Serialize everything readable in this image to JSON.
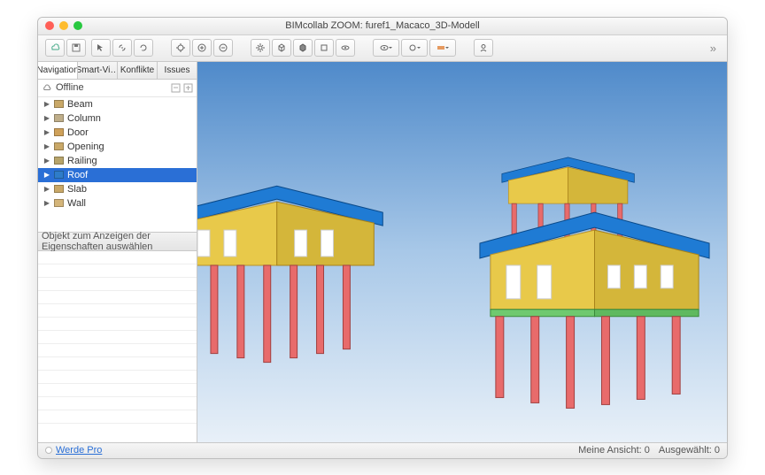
{
  "window": {
    "title": "BIMcollab ZOOM: furef1_Macaco_3D-Modell"
  },
  "toolbar_icons": [
    "cloud",
    "save",
    "arrow",
    "link",
    "sync",
    "target",
    "plus",
    "minus",
    "sun",
    "cube-wire",
    "cube",
    "box",
    "refresh",
    "eye",
    "eye2",
    "dots",
    "layers",
    "user"
  ],
  "sidebar": {
    "tabs": [
      "Navigation",
      "Smart-Vi…",
      "Konflikte",
      "Issues"
    ],
    "active_tab": 0,
    "offline_label": "Offline",
    "tree": [
      {
        "label": "Beam",
        "icon": "#c9a868",
        "selected": false
      },
      {
        "label": "Column",
        "icon": "#bfae8a",
        "selected": false
      },
      {
        "label": "Door",
        "icon": "#cfa15a",
        "selected": false
      },
      {
        "label": "Opening",
        "icon": "#c9a868",
        "selected": false
      },
      {
        "label": "Railing",
        "icon": "#b7a46a",
        "selected": false
      },
      {
        "label": "Roof",
        "icon": "#2e7cc9",
        "selected": true
      },
      {
        "label": "Slab",
        "icon": "#c9a868",
        "selected": false
      },
      {
        "label": "Wall",
        "icon": "#d4b57a",
        "selected": false
      }
    ],
    "props_placeholder": "Objekt zum Anzeigen der Eigenschaften auswählen"
  },
  "statusbar": {
    "upgrade_link": "Werde Pro",
    "view_label": "Meine Ansicht:",
    "view_count": "0",
    "selected_label": "Ausgewählt:",
    "selected_count": "0"
  }
}
